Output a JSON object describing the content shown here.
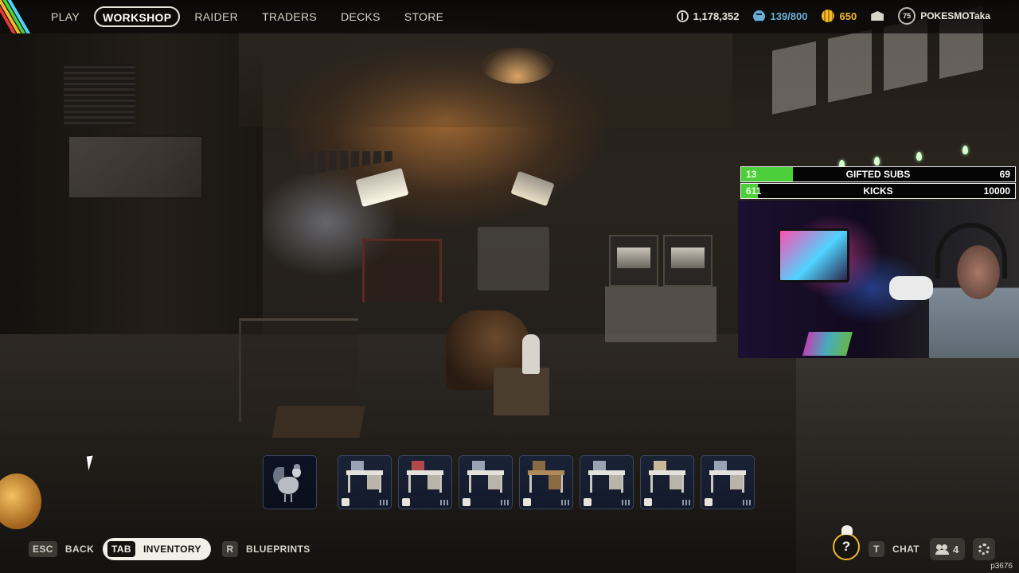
{
  "nav": {
    "items": [
      {
        "label": "PLAY",
        "active": false
      },
      {
        "label": "WORKSHOP",
        "active": true
      },
      {
        "label": "RAIDER",
        "active": false
      },
      {
        "label": "TRADERS",
        "active": false
      },
      {
        "label": "DECKS",
        "active": false
      },
      {
        "label": "STORE",
        "active": false
      }
    ]
  },
  "stats": {
    "coins": "1,178,352",
    "stash": "139/800",
    "raider_tokens": "650",
    "level": "75",
    "username": "POKESMOTaka"
  },
  "overlay": {
    "goals": [
      {
        "count": "13",
        "label": "GIFTED SUBS",
        "target": "69",
        "progress": 0.19
      },
      {
        "count": "611",
        "label": "KICKS",
        "target": "10000",
        "progress": 0.06
      }
    ]
  },
  "workshop": {
    "slots": [
      {
        "name": "rooster",
        "icon": "rooster-icon"
      },
      {
        "name": "bench-1",
        "icon": "home-icon"
      },
      {
        "name": "bench-2",
        "icon": "drop-icon"
      },
      {
        "name": "bench-3",
        "icon": "shield-icon"
      },
      {
        "name": "bench-4",
        "icon": "flask-icon"
      },
      {
        "name": "bench-5",
        "icon": "grid-icon"
      },
      {
        "name": "bench-6",
        "icon": "plus-icon"
      },
      {
        "name": "bench-7",
        "icon": "tools-icon"
      }
    ]
  },
  "bottom": {
    "back_key": "ESC",
    "back_label": "BACK",
    "inventory_key": "TAB",
    "inventory_label": "INVENTORY",
    "blueprints_key": "R",
    "blueprints_label": "BLUEPRINTS",
    "help_label": "?",
    "chat_key": "T",
    "chat_label": "CHAT",
    "friends_count": "4",
    "session_id": "p3676"
  },
  "colors": {
    "accent_yellow": "#f3b92c",
    "goal_green": "#4ccf3a",
    "stash_blue": "#6aaed6"
  }
}
